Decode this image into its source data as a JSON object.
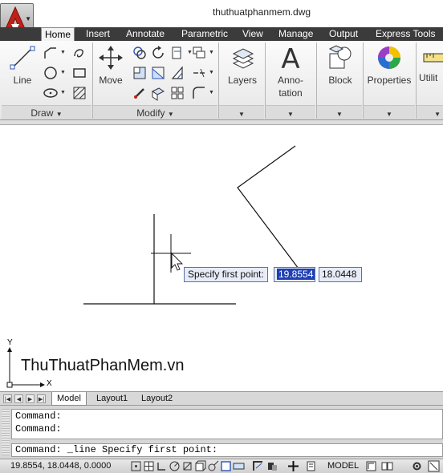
{
  "titlebar": {
    "document_title": "thuthuatphanmem.dwg"
  },
  "tabs": [
    "Home",
    "Insert",
    "Annotate",
    "Parametric",
    "View",
    "Manage",
    "Output",
    "Express Tools"
  ],
  "ribbon": {
    "draw": {
      "line_label": "Line",
      "panel_title": "Draw"
    },
    "modify": {
      "move_label": "Move",
      "panel_title": "Modify"
    },
    "layers_label": "Layers",
    "annotation_label_1": "Anno-",
    "annotation_label_2": "tation",
    "block_label": "Block",
    "properties_label": "Properties",
    "utilities_label": "Utilit"
  },
  "canvas": {
    "watermark": "ThuThuatPhanMem.vn",
    "axis_y": "Y",
    "axis_x": "X",
    "dynamic_input": {
      "prompt": "Specify first point:",
      "x_value": "19.8554",
      "y_value": "18.0448"
    }
  },
  "layout_tabs": [
    "Model",
    "Layout1",
    "Layout2"
  ],
  "command": {
    "history": [
      "Command:",
      "Command:"
    ],
    "current": "Command: _line Specify first point:"
  },
  "statusbar": {
    "coordinates": "19.8554, 18.0448, 0.0000",
    "model_label": "MODEL"
  },
  "colors": {
    "tab_bar": "#3b3b3b",
    "dyn_highlight": "#1e3fb5",
    "app_red": "#c0201a"
  }
}
